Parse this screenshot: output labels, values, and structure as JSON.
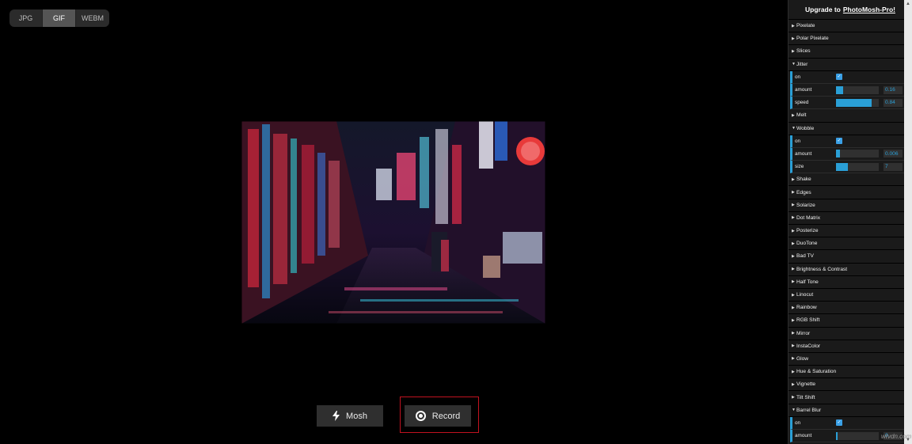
{
  "format_tabs": [
    {
      "label": "JPG",
      "active": false
    },
    {
      "label": "GIF",
      "active": true
    },
    {
      "label": "WEBM",
      "active": false
    }
  ],
  "actions": {
    "mosh_label": "Mosh",
    "record_label": "Record"
  },
  "panel": {
    "upgrade_prefix": "Upgrade to",
    "upgrade_link": "PhotoMosh-Pro!"
  },
  "effects": [
    {
      "label": "Pixelate",
      "expanded": false
    },
    {
      "label": "Polar Pixelate",
      "expanded": false
    },
    {
      "label": "Slices",
      "expanded": false
    },
    {
      "label": "Jitter",
      "expanded": true
    },
    {
      "label": "on",
      "type": "checkbox",
      "checked": true
    },
    {
      "label": "amount",
      "type": "slider",
      "value": 0.16,
      "display": "0.16"
    },
    {
      "label": "speed",
      "type": "slider",
      "value": 0.84,
      "display": "0.84"
    },
    {
      "label": "Melt",
      "expanded": false
    },
    {
      "label": "Wobble",
      "expanded": true
    },
    {
      "label": "on",
      "type": "checkbox",
      "checked": true
    },
    {
      "label": "amount",
      "type": "slider",
      "value": 0.1,
      "display": "0.006"
    },
    {
      "label": "size",
      "type": "slider",
      "value": 0.28,
      "display": "7"
    },
    {
      "label": "Shake",
      "expanded": false
    },
    {
      "label": "Edges",
      "expanded": false
    },
    {
      "label": "Solarize",
      "expanded": false
    },
    {
      "label": "Dot Matrix",
      "expanded": false
    },
    {
      "label": "Posterize",
      "expanded": false
    },
    {
      "label": "DuoTone",
      "expanded": false
    },
    {
      "label": "Bad TV",
      "expanded": false
    },
    {
      "label": "Brightness & Contrast",
      "expanded": false
    },
    {
      "label": "Half Tone",
      "expanded": false
    },
    {
      "label": "Linocut",
      "expanded": false
    },
    {
      "label": "Rainbow",
      "expanded": false
    },
    {
      "label": "RGB Shift",
      "expanded": false
    },
    {
      "label": "Mirror",
      "expanded": false
    },
    {
      "label": "InstaColor",
      "expanded": false
    },
    {
      "label": "Glow",
      "expanded": false
    },
    {
      "label": "Hue & Saturation",
      "expanded": false
    },
    {
      "label": "Vignette",
      "expanded": false
    },
    {
      "label": "Tilt Shift",
      "expanded": false
    },
    {
      "label": "Barrel Blur",
      "expanded": true
    },
    {
      "label": "on",
      "type": "checkbox",
      "checked": true
    },
    {
      "label": "amount",
      "type": "slider",
      "value": 0.03,
      "display": "0"
    }
  ],
  "watermark": "wtvdn.com",
  "colors": {
    "accent": "#2a9fd6",
    "record_frame": "#c1121f",
    "background": "#000000",
    "panel_bg": "#1a1a1a"
  }
}
